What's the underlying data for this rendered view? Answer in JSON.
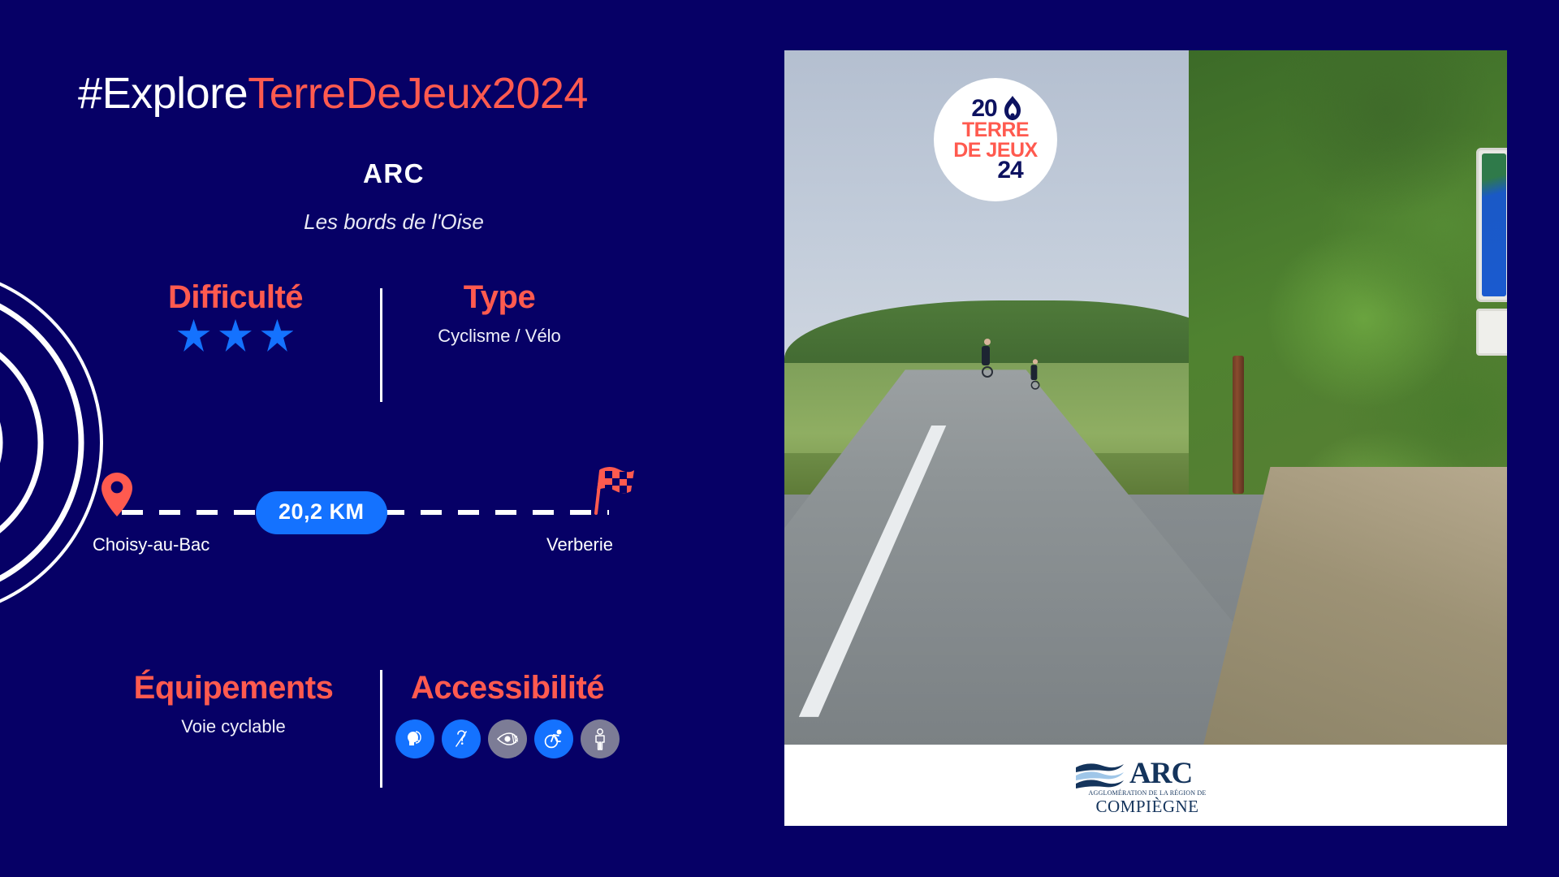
{
  "theme": {
    "background": "#060066",
    "accent_coral": "#ff5a4f",
    "accent_blue": "#1472ff",
    "white": "#ffffff",
    "muted_gray": "#7c7c96"
  },
  "hashtag": {
    "white_part": "#Explore",
    "coral_part": "TerreDeJeux2024"
  },
  "header": {
    "title": "ARC",
    "subtitle": "Les bords de l'Oise"
  },
  "difficulty": {
    "label": "Difficulté",
    "stars_filled": 3,
    "stars_total": 3
  },
  "type": {
    "label": "Type",
    "value": "Cyclisme / Vélo"
  },
  "route": {
    "start": "Choisy-au-Bac",
    "end": "Verberie",
    "distance": "20,2 KM",
    "start_icon": "map-pin-icon",
    "end_icon": "checkered-flag-icon"
  },
  "equipment": {
    "label": "Équipements",
    "value": "Voie cyclable"
  },
  "accessibility": {
    "label": "Accessibilité",
    "icons": [
      {
        "name": "mental-disability-icon",
        "active": true
      },
      {
        "name": "hearing-disability-icon",
        "active": true
      },
      {
        "name": "visual-disability-icon",
        "active": false
      },
      {
        "name": "motor-disability-icon",
        "active": true
      },
      {
        "name": "physical-disability-icon",
        "active": false
      }
    ]
  },
  "photo": {
    "alt": "Piste cyclable avec deux cyclistes le long de l'Oise",
    "badge": {
      "line1": "20",
      "line2": "TERRE",
      "line3": "DE JEUX",
      "line4": "24",
      "icon": "olympic-flame-icon"
    }
  },
  "footer_logo": {
    "name": "ARC",
    "subtitle_line1": "AGGLOMÉRATION DE LA RÉGION DE",
    "subtitle_line2": "COMPIÈGNE",
    "icon": "waves-icon"
  }
}
